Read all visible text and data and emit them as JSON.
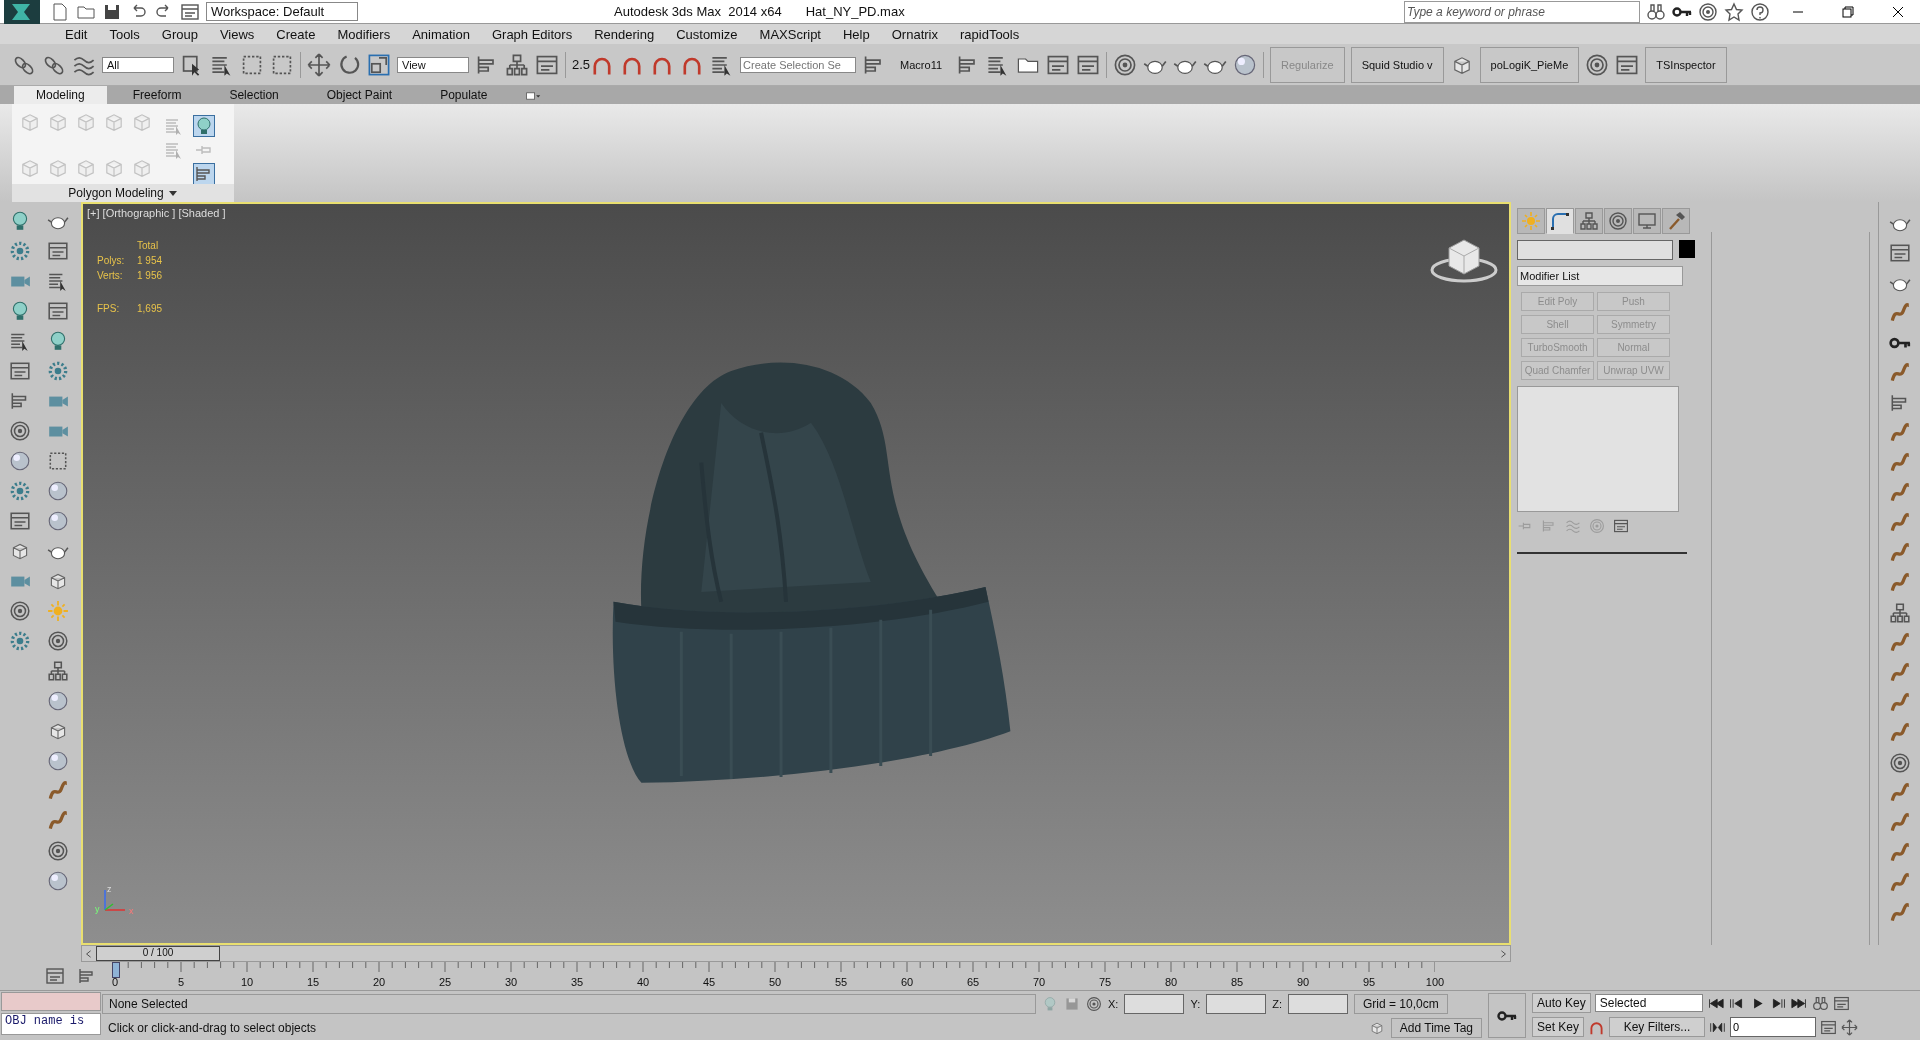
{
  "title_bar": {
    "app_title": "Autodesk 3ds Max  2014 x64",
    "file_name": "Hat_NY_PD.max",
    "workspace": "Workspace: Default",
    "search": {
      "placeholder": "Type a keyword or phrase"
    }
  },
  "menu": [
    "Edit",
    "Tools",
    "Group",
    "Views",
    "Create",
    "Modifiers",
    "Animation",
    "Graph Editors",
    "Rendering",
    "Customize",
    "MAXScript",
    "Help",
    "Ornatrix",
    "rapidTools"
  ],
  "main_toolbar": {
    "selection_filter": "All",
    "reference_coordinate": "View",
    "snap_label": "2.5",
    "named_selection": {
      "placeholder": "Create Selection Se"
    },
    "macro_label": "Macro11",
    "tool_buttons": [
      {
        "label": "Regularize",
        "disabled": true
      },
      {
        "label": "Squid Studio v",
        "disabled": false
      },
      {
        "label": "poLogiK_PieMe",
        "disabled": false
      },
      {
        "label": "TSInspector",
        "disabled": false
      }
    ]
  },
  "ribbon": {
    "tabs": [
      {
        "label": "Modeling",
        "selected": true
      },
      {
        "label": "Freeform",
        "selected": false
      },
      {
        "label": "Selection",
        "selected": false
      },
      {
        "label": "Object Paint",
        "selected": false
      },
      {
        "label": "Populate",
        "selected": false
      }
    ],
    "panel_title": "Polygon Modeling"
  },
  "viewport": {
    "label": "[+] [Orthographic ] [Shaded ]",
    "stats": {
      "header": "Total",
      "rows": [
        {
          "label": "Polys:",
          "value": "1 954"
        },
        {
          "label": "Verts:",
          "value": "1 956"
        }
      ],
      "fps_label": "FPS:",
      "fps_value": "1,695"
    },
    "axis_labels": [
      "z",
      "y",
      "x"
    ]
  },
  "command_panel": {
    "tabs": [
      {
        "kind": "create",
        "selected": false
      },
      {
        "kind": "modify",
        "selected": true
      },
      {
        "kind": "hierarchy",
        "selected": false
      },
      {
        "kind": "motion",
        "selected": false
      },
      {
        "kind": "display",
        "selected": false
      },
      {
        "kind": "utilities",
        "selected": false
      }
    ],
    "modifier_list": "Modifier List",
    "modifier_buttons": [
      {
        "label": "Edit Poly",
        "disabled": true
      },
      {
        "label": "Push",
        "disabled": true
      },
      {
        "label": "Shell",
        "disabled": true
      },
      {
        "label": "Symmetry",
        "disabled": true
      },
      {
        "label": "TurboSmooth",
        "disabled": true
      },
      {
        "label": "Normal",
        "disabled": true
      },
      {
        "label": "Quad Chamfer",
        "disabled": true
      },
      {
        "label": "Unwrap UVW",
        "disabled": true
      }
    ]
  },
  "time_slider": {
    "position": "0 / 100",
    "level": 0,
    "ruler_labels": [
      "0",
      "5",
      "10",
      "15",
      "20",
      "25",
      "30",
      "35",
      "40",
      "45",
      "50",
      "55",
      "60",
      "65",
      "70",
      "75",
      "80",
      "85",
      "90",
      "95",
      "100"
    ]
  },
  "status_bar": {
    "listener": "OBJ name is",
    "selection": "None Selected",
    "prompt": "Click or click-and-drag to select objects",
    "coords": [
      "X:",
      "Y:",
      "Z:"
    ],
    "grid": "Grid = 10,0cm",
    "time_tag": "Add Time Tag",
    "auto_key": "Auto Key",
    "key_mode": "Selected",
    "set_key": "Set Key",
    "key_filters": "Key Filters...",
    "frame": "0"
  }
}
